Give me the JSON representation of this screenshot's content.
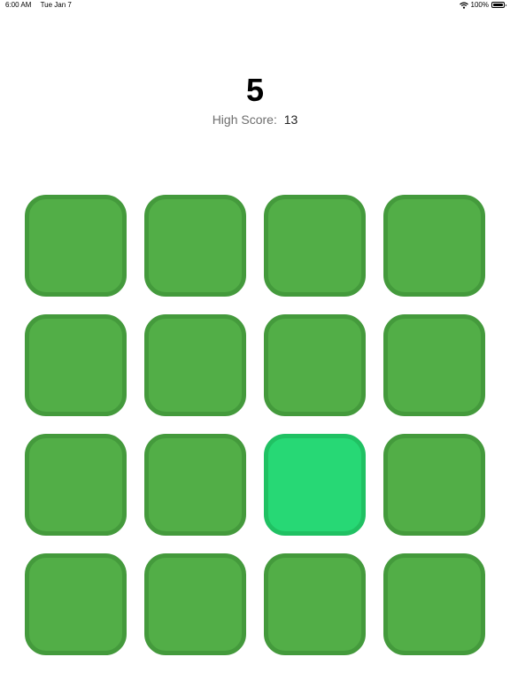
{
  "status_bar": {
    "time": "6:00 AM",
    "date": "Tue Jan 7",
    "battery": "100%"
  },
  "game": {
    "score": "5",
    "high_score_label": "High Score:",
    "high_score_value": "13"
  },
  "colors": {
    "tile_fill": "#52ae47",
    "tile_border": "#449a3c",
    "active_fill": "#27d875",
    "active_border": "#20c163"
  },
  "grid": {
    "rows": 4,
    "columns": 4,
    "highlighted": {
      "row": 3,
      "column": 3
    }
  }
}
